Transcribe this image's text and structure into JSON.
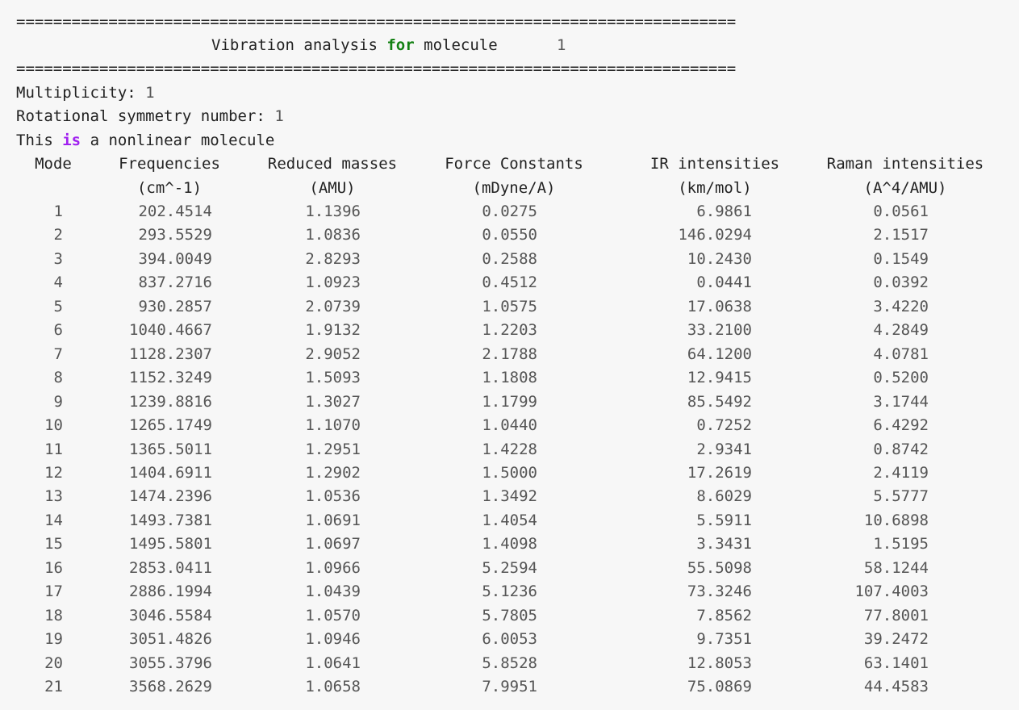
{
  "separator": "==============================================================================",
  "title": {
    "prefix": "Vibration analysis",
    "keyword_for": "for",
    "suffix": "molecule",
    "molecule_number": "1"
  },
  "info": {
    "multiplicity_label": "Multiplicity:",
    "multiplicity_value": "1",
    "symmetry_label": "Rotational symmetry number:",
    "symmetry_value": "1",
    "nonlinear_this": "This",
    "nonlinear_is": "is",
    "nonlinear_rest": "a nonlinear molecule"
  },
  "table": {
    "headers": [
      "Mode",
      "Frequencies",
      "Reduced masses",
      "Force Constants",
      "IR intensities",
      "Raman intensities"
    ],
    "units": [
      "",
      "(cm^-1)",
      "(AMU)",
      "(mDyne/A)",
      "(km/mol)",
      "(A^4/AMU)"
    ],
    "rows": [
      [
        "1",
        "202.4514",
        "1.1396",
        "0.0275",
        "6.9861",
        "0.0561"
      ],
      [
        "2",
        "293.5529",
        "1.0836",
        "0.0550",
        "146.0294",
        "2.1517"
      ],
      [
        "3",
        "394.0049",
        "2.8293",
        "0.2588",
        "10.2430",
        "0.1549"
      ],
      [
        "4",
        "837.2716",
        "1.0923",
        "0.4512",
        "0.0441",
        "0.0392"
      ],
      [
        "5",
        "930.2857",
        "2.0739",
        "1.0575",
        "17.0638",
        "3.4220"
      ],
      [
        "6",
        "1040.4667",
        "1.9132",
        "1.2203",
        "33.2100",
        "4.2849"
      ],
      [
        "7",
        "1128.2307",
        "2.9052",
        "2.1788",
        "64.1200",
        "4.0781"
      ],
      [
        "8",
        "1152.3249",
        "1.5093",
        "1.1808",
        "12.9415",
        "0.5200"
      ],
      [
        "9",
        "1239.8816",
        "1.3027",
        "1.1799",
        "85.5492",
        "3.1744"
      ],
      [
        "10",
        "1265.1749",
        "1.1070",
        "1.0440",
        "0.7252",
        "6.4292"
      ],
      [
        "11",
        "1365.5011",
        "1.2951",
        "1.4228",
        "2.9341",
        "0.8742"
      ],
      [
        "12",
        "1404.6911",
        "1.2902",
        "1.5000",
        "17.2619",
        "2.4119"
      ],
      [
        "13",
        "1474.2396",
        "1.0536",
        "1.3492",
        "8.6029",
        "5.5777"
      ],
      [
        "14",
        "1493.7381",
        "1.0691",
        "1.4054",
        "5.5911",
        "10.6898"
      ],
      [
        "15",
        "1495.5801",
        "1.0697",
        "1.4098",
        "3.3431",
        "1.5195"
      ],
      [
        "16",
        "2853.0411",
        "1.0966",
        "5.2594",
        "55.5098",
        "58.1244"
      ],
      [
        "17",
        "2886.1994",
        "1.0439",
        "5.1236",
        "73.3246",
        "107.4003"
      ],
      [
        "18",
        "3046.5584",
        "1.0570",
        "5.7805",
        "7.8562",
        "77.8001"
      ],
      [
        "19",
        "3051.4826",
        "1.0946",
        "6.0053",
        "9.7351",
        "39.2472"
      ],
      [
        "20",
        "3055.3796",
        "1.0641",
        "5.8528",
        "12.8053",
        "63.1401"
      ],
      [
        "21",
        "3568.2629",
        "1.0658",
        "7.9951",
        "75.0869",
        "44.4583"
      ]
    ]
  }
}
